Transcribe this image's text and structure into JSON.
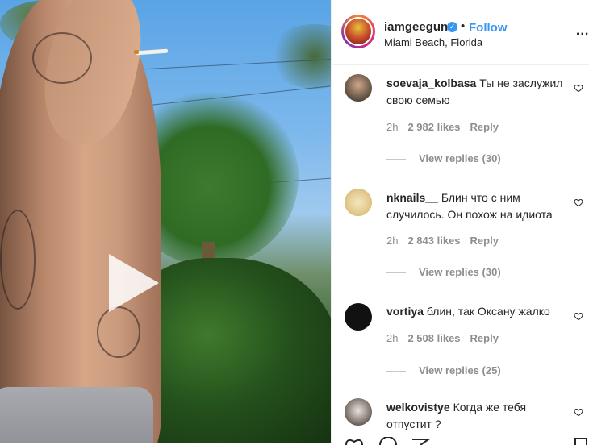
{
  "post": {
    "username": "iamgeegun",
    "follow_label": "Follow",
    "separator": "•",
    "location": "Miami Beach, Florida",
    "more_label": "..."
  },
  "comments": [
    {
      "username": "soevaja_kolbasa",
      "text": "Ты не заслужил свою семью",
      "time": "2h",
      "likes": "2 982 likes",
      "reply_label": "Reply",
      "view_replies": "View replies (30)"
    },
    {
      "username": "nknails__",
      "text": "Блин что с ним случилось. Он похож на идиота",
      "time": "2h",
      "likes": "2 843 likes",
      "reply_label": "Reply",
      "view_replies": "View replies (30)"
    },
    {
      "username": "vortiya",
      "text": "блин, так Оксану жалко",
      "time": "2h",
      "likes": "2 508 likes",
      "reply_label": "Reply",
      "view_replies": "View replies (25)"
    },
    {
      "username": "welkovistye",
      "text": "Когда же тебя отпустит ?"
    }
  ],
  "icons": {
    "verified": "verified-badge-icon",
    "play": "play-icon",
    "heart": "heart-icon"
  },
  "colors": {
    "follow": "#3897f0",
    "verified": "#3897f0",
    "meta_text": "#8e8e8e"
  }
}
